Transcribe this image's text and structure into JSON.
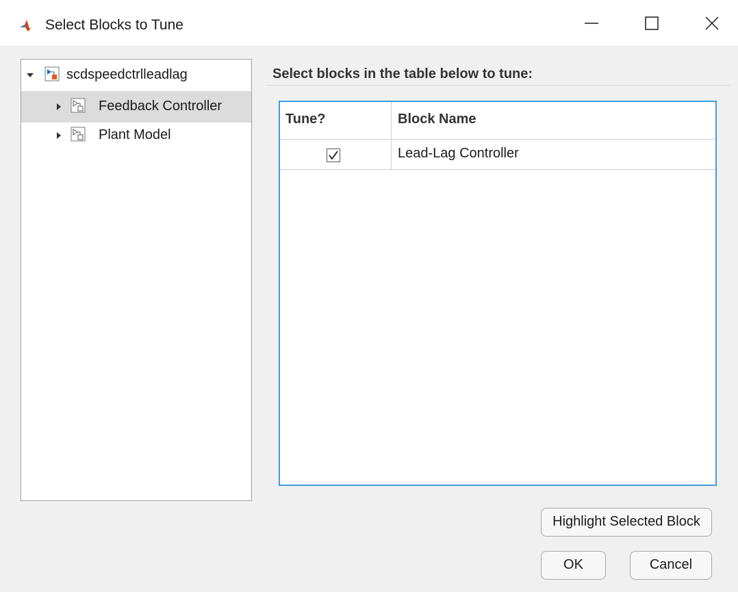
{
  "window": {
    "title": "Select Blocks to Tune",
    "icon": "matlab-logo-icon",
    "controls": [
      "minimize-icon",
      "maximize-icon",
      "close-icon"
    ]
  },
  "tree": {
    "nodes": [
      {
        "label": "scdspeedctrlleadlag",
        "expanded": true,
        "icon": "model-icon",
        "level": 0
      },
      {
        "label": "Feedback Controller",
        "expanded": false,
        "icon": "subsystem-icon",
        "level": 1,
        "selected": true
      },
      {
        "label": "Plant Model",
        "expanded": false,
        "icon": "subsystem-icon",
        "level": 1
      }
    ]
  },
  "main": {
    "instruction": "Select blocks in the table below to tune:",
    "table": {
      "columns": [
        "Tune?",
        "Block Name"
      ],
      "rows": [
        {
          "tune": true,
          "name": "Lead-Lag Controller"
        }
      ]
    }
  },
  "buttons": {
    "highlight": "Highlight Selected Block",
    "ok": "OK",
    "cancel": "Cancel"
  },
  "colors": {
    "table_border": "#3d9fe0",
    "selected_row": "#dcdcdc",
    "icon_accent_blue": "#1a6fc7",
    "icon_accent_orange": "#e35a1b"
  }
}
